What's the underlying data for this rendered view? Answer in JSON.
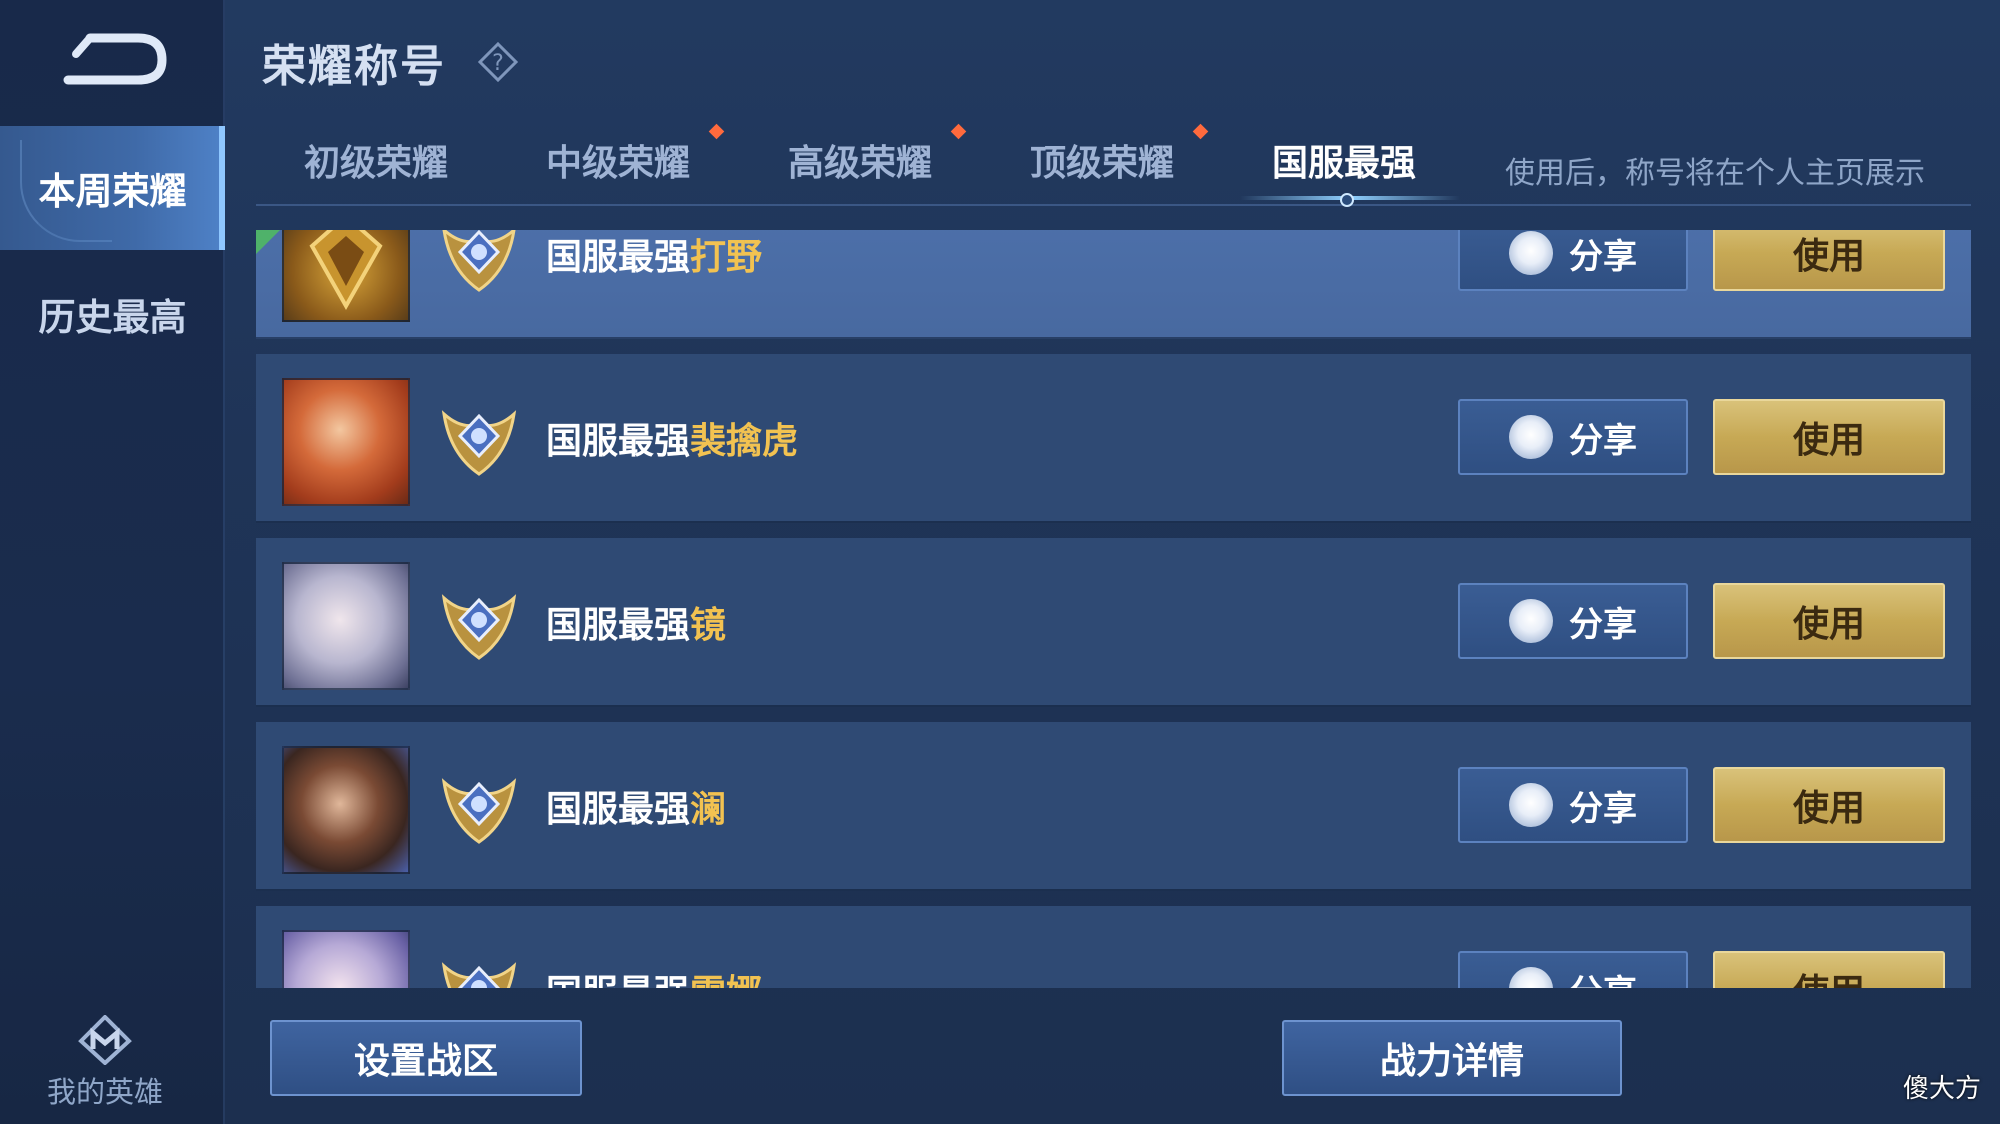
{
  "page": {
    "title": "荣耀称号",
    "tab_note": "使用后，称号将在个人主页展示",
    "watermark": "傻大方"
  },
  "sidebar": {
    "items": [
      {
        "label": "本周荣耀",
        "active": true
      },
      {
        "label": "历史最高",
        "active": false
      }
    ],
    "my_hero_label": "我的英雄"
  },
  "tabs": [
    {
      "label": "初级荣耀",
      "dot": false,
      "active": false
    },
    {
      "label": "中级荣耀",
      "dot": true,
      "active": false
    },
    {
      "label": "高级荣耀",
      "dot": true,
      "active": false
    },
    {
      "label": "顶级荣耀",
      "dot": true,
      "active": false
    },
    {
      "label": "国服最强",
      "dot": false,
      "active": true
    }
  ],
  "rows": [
    {
      "prefix": "国服最强",
      "hero": "打野",
      "share": "分享",
      "use": "使用",
      "selected": true
    },
    {
      "prefix": "国服最强",
      "hero": "裴擒虎",
      "share": "分享",
      "use": "使用",
      "selected": false
    },
    {
      "prefix": "国服最强",
      "hero": "镜",
      "share": "分享",
      "use": "使用",
      "selected": false
    },
    {
      "prefix": "国服最强",
      "hero": "澜",
      "share": "分享",
      "use": "使用",
      "selected": false
    },
    {
      "prefix": "国服最强",
      "hero": "雪娜",
      "share": "分享",
      "use": "使用",
      "selected": false
    }
  ],
  "bottom": {
    "set_region": "设置战区",
    "power_detail": "战力详情"
  },
  "colors": {
    "accent_gold": "#f2c251",
    "use_button": "#c7a955",
    "dot": "#ff6a3d"
  }
}
